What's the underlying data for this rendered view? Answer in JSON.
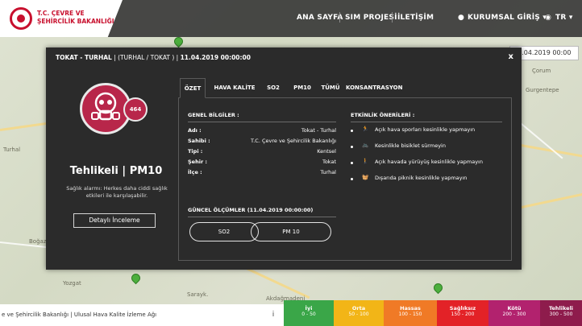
{
  "header": {
    "logo_line1": "T.C. ÇEVRE VE",
    "logo_line2": "ŞEHİRCİLİK BAKANLIĞI",
    "nav": [
      "ANA SAYFA",
      "SIM PROJESİ",
      "İLETİŞİM"
    ],
    "login": "KURUMSAL GİRİŞ",
    "lang": "TR"
  },
  "date_field": {
    "value": "11.04.2019 00:00"
  },
  "map_labels": [
    "Çorum",
    "Gurgentepe",
    "Turhal",
    "Yozgat",
    "Sarayk.",
    "Akdağmadeni",
    "Boğazlıyan"
  ],
  "modal": {
    "title_main": "TOKAT - TURHAL",
    "title_sub": "(TURHAL / TOKAT )",
    "title_date": "11.04.2019 00:00:00",
    "close": "x",
    "aqi_value": "464",
    "status": "Tehlikeli",
    "pollutant": "PM10",
    "description": "Sağlık alarmı: Herkes daha ciddi sağlık etkileri ile karşılaşabilir.",
    "detail_button": "Detaylı İnceleme",
    "tabs": [
      "ÖZET",
      "HAVA KALİTE",
      "SO2",
      "PM10",
      "TÜMÜ",
      "KONSANTRASYON"
    ],
    "general_title": "GENEL BİLGİLER :",
    "general": [
      {
        "label": "Adı :",
        "value": "Tokat - Turhal"
      },
      {
        "label": "Sahibi :",
        "value": "T.C. Çevre ve Şehircilik Bakanlığı"
      },
      {
        "label": "Tipi :",
        "value": "Kentsel"
      },
      {
        "label": "Şehir :",
        "value": "Tokat"
      },
      {
        "label": "İlçe :",
        "value": "Turhal"
      }
    ],
    "tips_title": "ETKİNLİK ÖNERİLERİ :",
    "tips": [
      "Açık hava sporları kesinlikle yapmayın",
      "Kesinlikle bisiklet sürmeyin",
      "Açık havada yürüyüş kesinlikle yapmayın",
      "Dışarıda piknik kesinlikle yapmayın"
    ],
    "measure_title": "GÜNCEL ÖLÇÜMLER (11.04.2019 00:00:00)",
    "measure_buttons": [
      "SO2",
      "PM 10"
    ]
  },
  "footer": {
    "text": "e ve Şehircilik Bakanlığı | Ulusal Hava Kalite İzleme Ağı",
    "info_icon": "i"
  },
  "legend": [
    {
      "label": "İyi",
      "range": "0 - 50",
      "color": "#3aa648"
    },
    {
      "label": "Orta",
      "range": "50 - 100",
      "color": "#f2b517"
    },
    {
      "label": "Hassas",
      "range": "100 - 150",
      "color": "#f07a26"
    },
    {
      "label": "Sağlıksız",
      "range": "150 - 200",
      "color": "#e32227"
    },
    {
      "label": "Kötü",
      "range": "200 - 300",
      "color": "#b2226e"
    },
    {
      "label": "Tehlikeli",
      "range": "300 - 500",
      "color": "#8e1c4c"
    }
  ],
  "colors": {
    "status_accent": "#b8264a",
    "modal_bg": "#2b2b2b"
  }
}
